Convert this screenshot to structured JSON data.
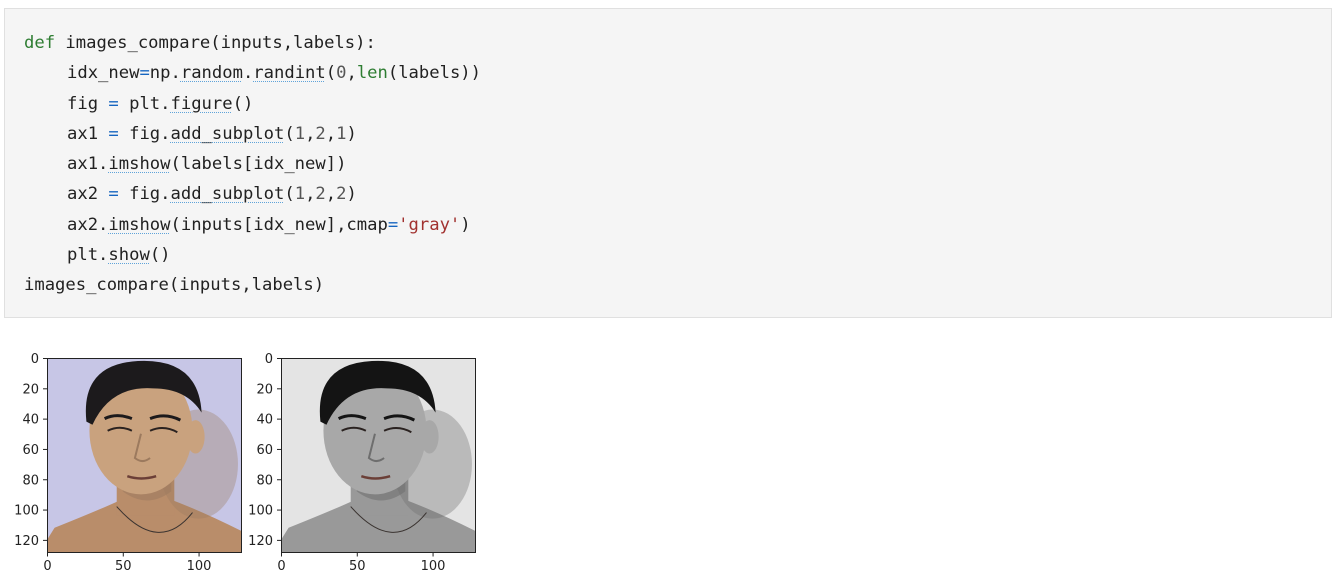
{
  "code_cell": {
    "lines": [
      {
        "indent": 0,
        "tokens": [
          {
            "t": "def",
            "c": "kw"
          },
          {
            "t": " images_compare(inputs,labels):",
            "c": ""
          }
        ]
      },
      {
        "indent": 1,
        "tokens": [
          {
            "t": "idx_new",
            "c": ""
          },
          {
            "t": "=",
            "c": "op"
          },
          {
            "t": "np.",
            "c": ""
          },
          {
            "t": "random",
            "c": "fn"
          },
          {
            "t": ".",
            "c": ""
          },
          {
            "t": "randint",
            "c": "fn"
          },
          {
            "t": "(",
            "c": ""
          },
          {
            "t": "0",
            "c": "num"
          },
          {
            "t": ",",
            "c": ""
          },
          {
            "t": "len",
            "c": "kw"
          },
          {
            "t": "(labels))",
            "c": ""
          }
        ]
      },
      {
        "indent": 1,
        "tokens": [
          {
            "t": "fig ",
            "c": ""
          },
          {
            "t": "=",
            "c": "op"
          },
          {
            "t": " plt.",
            "c": ""
          },
          {
            "t": "figure",
            "c": "fn"
          },
          {
            "t": "()",
            "c": ""
          }
        ]
      },
      {
        "indent": 1,
        "tokens": [
          {
            "t": "ax1 ",
            "c": ""
          },
          {
            "t": "=",
            "c": "op"
          },
          {
            "t": " fig.",
            "c": ""
          },
          {
            "t": "add_subplot",
            "c": "fn"
          },
          {
            "t": "(",
            "c": ""
          },
          {
            "t": "1",
            "c": "num"
          },
          {
            "t": ",",
            "c": ""
          },
          {
            "t": "2",
            "c": "num"
          },
          {
            "t": ",",
            "c": ""
          },
          {
            "t": "1",
            "c": "num"
          },
          {
            "t": ")",
            "c": ""
          }
        ]
      },
      {
        "indent": 1,
        "tokens": [
          {
            "t": "ax1.",
            "c": ""
          },
          {
            "t": "imshow",
            "c": "fn"
          },
          {
            "t": "(labels[idx_new])",
            "c": ""
          }
        ]
      },
      {
        "indent": 1,
        "tokens": [
          {
            "t": "ax2 ",
            "c": ""
          },
          {
            "t": "=",
            "c": "op"
          },
          {
            "t": " fig.",
            "c": ""
          },
          {
            "t": "add_subplot",
            "c": "fn"
          },
          {
            "t": "(",
            "c": ""
          },
          {
            "t": "1",
            "c": "num"
          },
          {
            "t": ",",
            "c": ""
          },
          {
            "t": "2",
            "c": "num"
          },
          {
            "t": ",",
            "c": ""
          },
          {
            "t": "2",
            "c": "num"
          },
          {
            "t": ")",
            "c": ""
          }
        ]
      },
      {
        "indent": 1,
        "tokens": [
          {
            "t": "ax2.",
            "c": ""
          },
          {
            "t": "imshow",
            "c": "fn"
          },
          {
            "t": "(inputs[idx_new],cmap",
            "c": ""
          },
          {
            "t": "=",
            "c": "op"
          },
          {
            "t": "'gray'",
            "c": "str"
          },
          {
            "t": ")",
            "c": ""
          }
        ]
      },
      {
        "indent": 1,
        "tokens": [
          {
            "t": "plt.",
            "c": ""
          },
          {
            "t": "show",
            "c": "fn"
          },
          {
            "t": "()",
            "c": ""
          }
        ]
      },
      {
        "indent": 0,
        "tokens": [
          {
            "t": "images_compare(inputs,labels)",
            "c": ""
          }
        ]
      }
    ]
  },
  "output": {
    "panels": [
      {
        "name": "color",
        "y_ticks": [
          "0",
          "20",
          "40",
          "60",
          "80",
          "100",
          "120"
        ],
        "x_ticks": [
          "0",
          "50",
          "100"
        ],
        "palette": {
          "bg": "#c7c6e6",
          "skin": "#c9a27e",
          "hair": "#1c1a1c",
          "shadow": "#9c7a5e",
          "neck": "#b98d6a"
        }
      },
      {
        "name": "gray",
        "y_ticks": [
          "0",
          "20",
          "40",
          "60",
          "80",
          "100",
          "120"
        ],
        "x_ticks": [
          "0",
          "50",
          "100"
        ],
        "palette": {
          "bg": "#e4e4e4",
          "skin": "#a8a8a8",
          "hair": "#141414",
          "shadow": "#6e6e6e",
          "neck": "#999999"
        }
      }
    ]
  }
}
